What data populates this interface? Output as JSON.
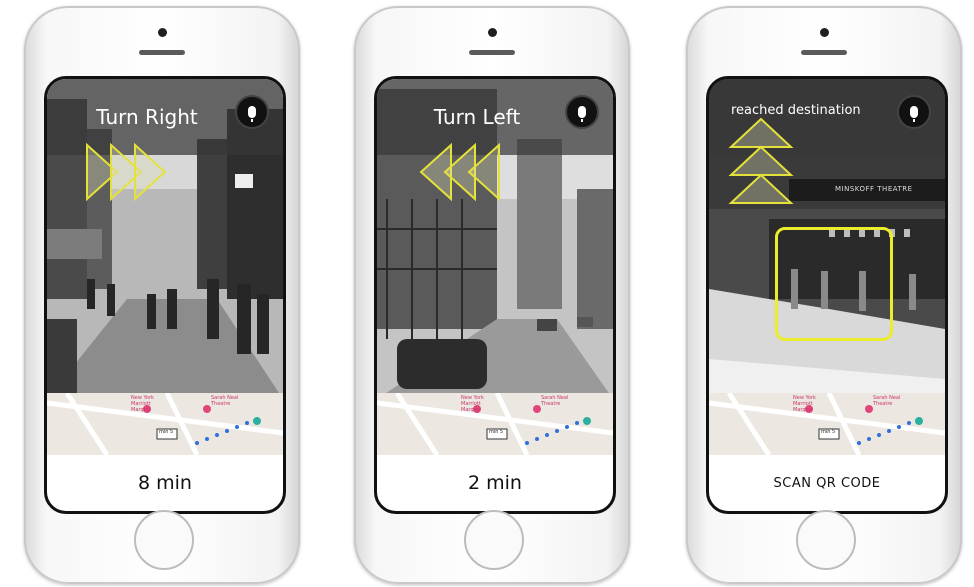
{
  "phones": [
    {
      "instruction": "Turn Right",
      "arrow_direction": "right",
      "duration": "8 min",
      "mic_icon": "microphone-icon"
    },
    {
      "instruction": "Turn Left",
      "arrow_direction": "left",
      "duration": "2 min",
      "mic_icon": "microphone-icon"
    },
    {
      "instruction": "reached destination",
      "arrow_direction": "up",
      "bottom_action": "SCAN QR CODE",
      "sign_text": "MINSKOFF THEATRE",
      "mic_icon": "microphone-icon"
    }
  ],
  "map": {
    "eta_label": "min 5",
    "poi_1": "New York Marriott Marquis",
    "poi_2": "Sarah Neal Theatre"
  },
  "colors": {
    "arrow_outline": "#e4e23a",
    "target_box": "#ecec2a",
    "route": "#2f6fe0"
  }
}
